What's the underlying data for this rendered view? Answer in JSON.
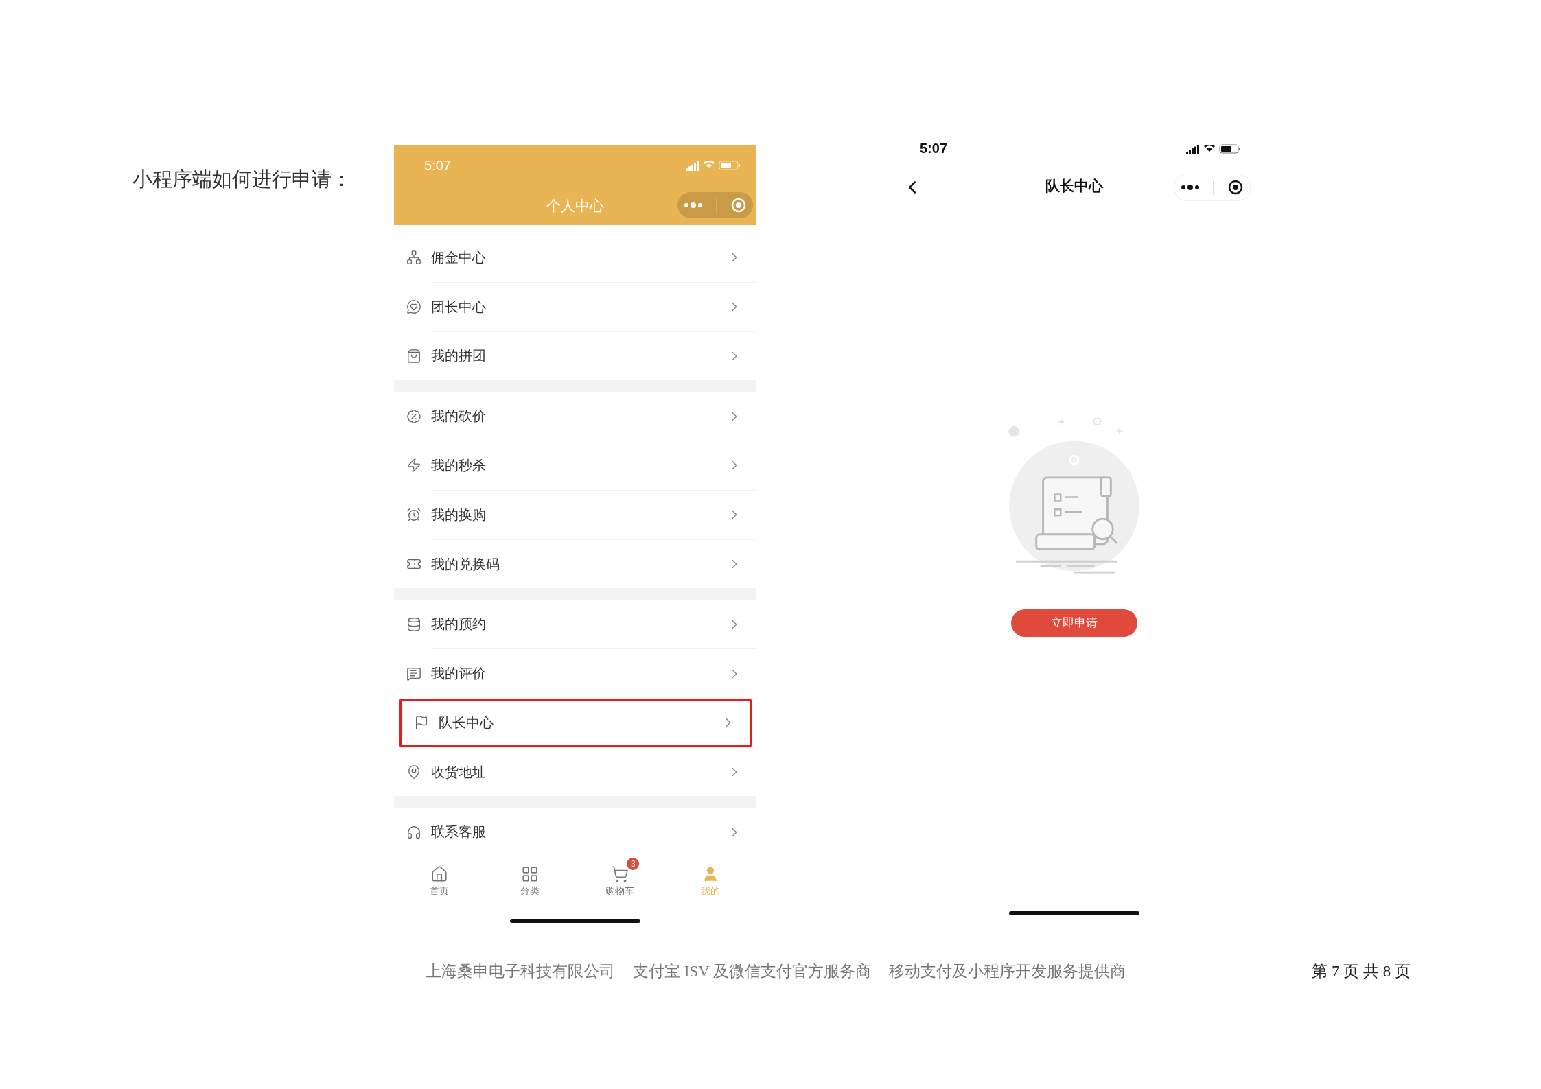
{
  "heading": "小程序端如何进行申请：",
  "phone_left": {
    "status_time": "5:07",
    "title": "个人中心",
    "menu_groups": [
      [
        {
          "label": "佣金中心",
          "highlighted": false
        },
        {
          "label": "团长中心",
          "highlighted": false
        },
        {
          "label": "我的拼团",
          "highlighted": false
        }
      ],
      [
        {
          "label": "我的砍价",
          "highlighted": false
        },
        {
          "label": "我的秒杀",
          "highlighted": false
        },
        {
          "label": "我的换购",
          "highlighted": false
        },
        {
          "label": "我的兑换码",
          "highlighted": false
        }
      ],
      [
        {
          "label": "我的预约",
          "highlighted": false
        },
        {
          "label": "我的评价",
          "highlighted": false
        },
        {
          "label": "队长中心",
          "highlighted": true
        },
        {
          "label": "收货地址",
          "highlighted": false
        }
      ],
      [
        {
          "label": "联系客服",
          "highlighted": false
        }
      ]
    ],
    "tabs": [
      {
        "label": "首页",
        "selected": false
      },
      {
        "label": "分类",
        "selected": false
      },
      {
        "label": "购物车",
        "selected": false,
        "badge": "3"
      },
      {
        "label": "我的",
        "selected": true
      }
    ]
  },
  "phone_right": {
    "status_time": "5:07",
    "title": "队长中心",
    "apply_button": "立即申请"
  },
  "footer": {
    "texts": [
      "上海桑申电子科技有限公司",
      "支付宝 ISV 及微信支付官方服务商",
      "移动支付及小程序开发服务提供商"
    ],
    "page_number": "第 7 页 共 8 页"
  }
}
